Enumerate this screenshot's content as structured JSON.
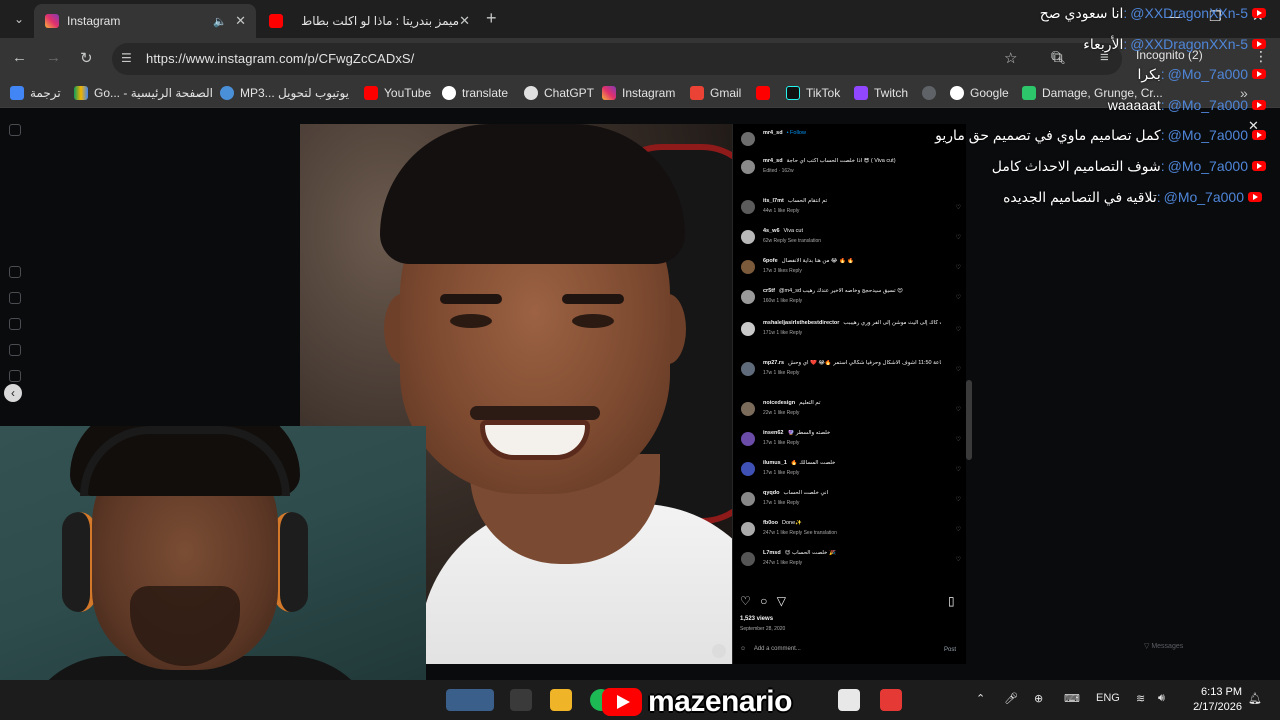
{
  "browser": {
    "tabs": [
      {
        "title": "Instagram",
        "active": true
      },
      {
        "title": "ميمز بندريتا : ماذا لو اكلت بطاط",
        "active": false
      }
    ],
    "url": "https://www.instagram.com/p/CFwgZcCADxS/",
    "incognito_label": "Incognito (2)",
    "bookmarks": [
      {
        "label": "ترجمة",
        "icon": "translate-icon"
      },
      {
        "label": "Go... - الصفحة الرئيسية",
        "icon": "google-drive-icon"
      },
      {
        "label": "MP3... يوتيوب لتحويل",
        "icon": "cloud-icon"
      },
      {
        "label": "YouTube",
        "icon": "youtube-icon"
      },
      {
        "label": "translate",
        "icon": "google-icon"
      },
      {
        "label": "ChatGPT",
        "icon": "chatgpt-icon"
      },
      {
        "label": "Instagram",
        "icon": "instagram-icon"
      },
      {
        "label": "Gmail",
        "icon": "gmail-icon"
      },
      {
        "label": "TikTok",
        "icon": "tiktok-icon"
      },
      {
        "label": "Twitch",
        "icon": "twitch-icon"
      },
      {
        "label": "Google",
        "icon": "google-icon"
      },
      {
        "label": "Damage, Grunge, Cr...",
        "icon": "pixabay-icon"
      }
    ],
    "colors": {
      "chrome_dark": "#1f1f1f",
      "toolbar": "#353535",
      "accent_red": "#ff0000"
    }
  },
  "instagram": {
    "comments": [
      {
        "user": "mr4_sd",
        "text": "• Follow",
        "meta": ""
      },
      {
        "user": "mr4_sd",
        "text": "اذا خلصت الحساب اكتب اي حاجة 😎 ( Viva cut)",
        "meta": "Edited · 162w"
      },
      {
        "user": "its_l7mt",
        "text": "تم انتقام الحساب",
        "meta": "44w  1 like  Reply"
      },
      {
        "user": "4s_w6",
        "text": "Viva cut",
        "meta": "62w  Reply  See translation"
      },
      {
        "user": "6pofe",
        "text": "من هنا بداية الانفصال 😂 🔥 🔥",
        "meta": "17w  3 likes  Reply"
      },
      {
        "user": "cr5tf",
        "text": "@m4_sd تسيق سيدحجج وخاصه الاخير عندك رهيب 😍",
        "meta": "160w  1 like  Reply"
      },
      {
        "user": "mshaleljasirlsthebestdirector",
        "text": "وما شاء الله يالعطور الرهيب من قاب كاك إلى اليث موشن إلى الفر وري رهيببب",
        "meta": "171w  1 like  Reply"
      },
      {
        "user": "mp27.rs",
        "text": "حرفيا من الساعة 11:50 اشوف الاشكال وحرفيا شكالي استمر 🔥😂 ❤️ اي وحش",
        "meta": "17w  1 like  Reply"
      },
      {
        "user": "noicedesign",
        "text": "تم التعليم",
        "meta": "22w  1 like  Reply"
      },
      {
        "user": "insen62",
        "text": "🔮 خلصته والسطر",
        "meta": "17w  1 like  Reply"
      },
      {
        "user": "ilumus_1",
        "text": "🔥 خلصت المسالك",
        "meta": "17w  1 like  Reply"
      },
      {
        "user": "qyqdo",
        "text": "اني خلصت الحساب",
        "meta": "17w  1 like  Reply"
      },
      {
        "user": "fb0oo",
        "text": "Done✨",
        "meta": "247w  1 like  Reply  See translation"
      },
      {
        "user": "L7msd",
        "text": "😍 خلصت الحساب 🎉",
        "meta": "247w  1 like  Reply"
      }
    ],
    "views": "1,523 views",
    "date": "September 28, 2020",
    "add_comment_placeholder": "Add a comment...",
    "post_label": "Post",
    "messages_label": "Messages"
  },
  "stream": {
    "chat": [
      {
        "handle": "@XXDragonXXn-5",
        "msg": "انا سعودي صح"
      },
      {
        "handle": "@XXDragonXXn-5",
        "msg": "الأربعاء"
      },
      {
        "handle": "@Mo_7a000",
        "msg": "بكرا"
      },
      {
        "handle": "@Mo_7a000",
        "msg": "waaaaat"
      },
      {
        "handle": "@Mo_7a000",
        "msg": "كمل تصاميم ماوي في تصميم حق ماريو"
      },
      {
        "handle": "@Mo_7a000",
        "msg": "شوف التصاميم الاحداث كامل"
      },
      {
        "handle": "@Mo_7a000",
        "msg": "تلاقيه في التصاميم الجديده"
      }
    ],
    "channel_name": "mazenario",
    "colors": {
      "handle": "#4f86d9",
      "badge": "#ff0000"
    }
  },
  "taskbar": {
    "language": "ENG",
    "time": "6:13 PM",
    "date": "2/17/2026"
  }
}
